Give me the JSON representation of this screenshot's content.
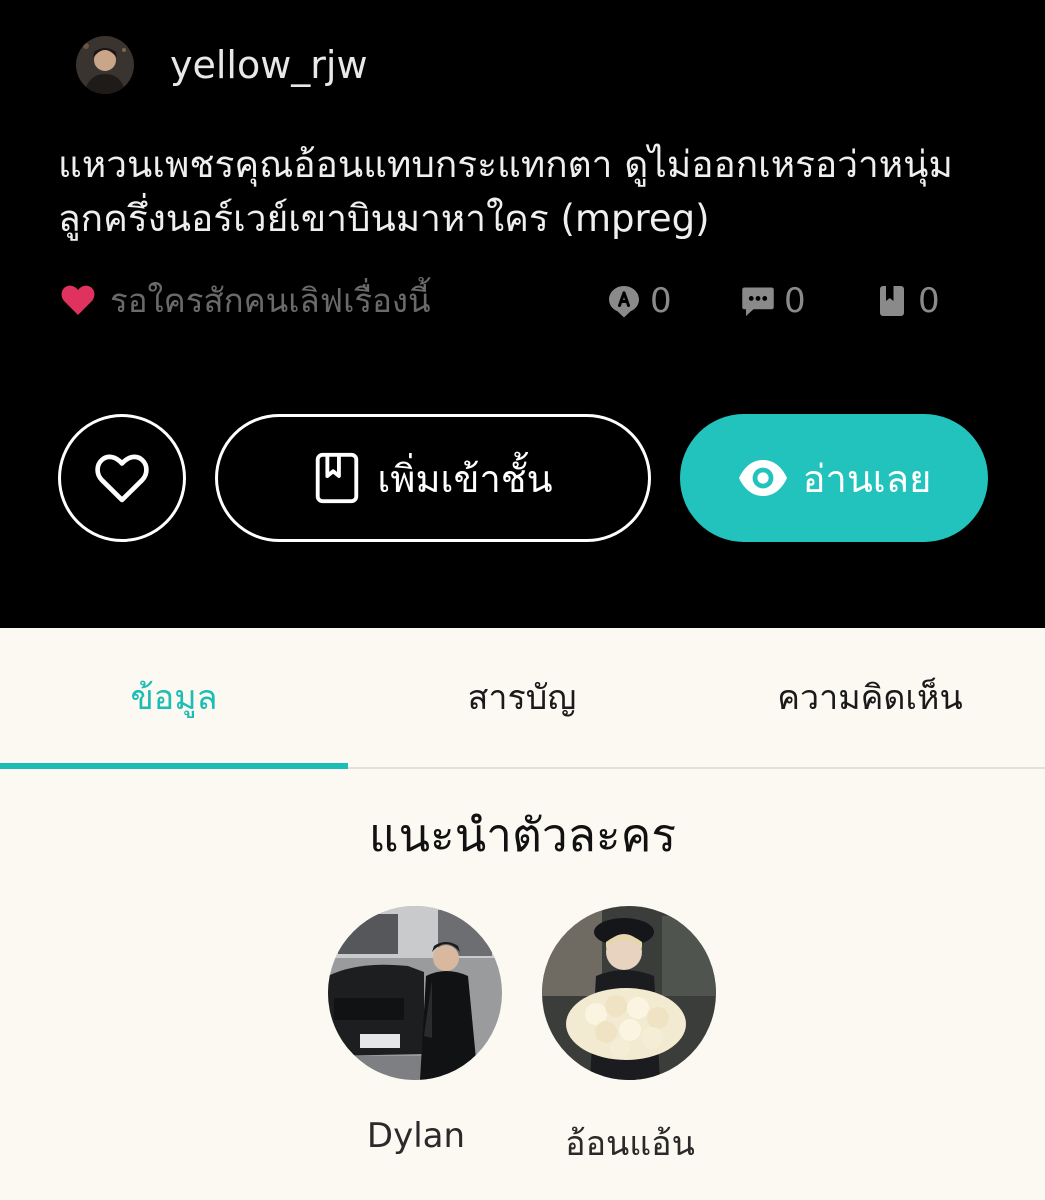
{
  "author": {
    "username": "yellow_rjw"
  },
  "story": {
    "title": "แหวนเพชรคุณอ้อนแทบกระแทกตา ดูไม่ออกเหรอว่าหนุ่มลูกครึ่งนอร์เวย์เขาบินมาหาใคร (mpreg)",
    "likes_text": "รอใครสักคนเลิฟเรื่องนี้",
    "stats": {
      "chapters": "0",
      "comments": "0",
      "shelves": "0"
    }
  },
  "actions": {
    "add_to_shelf": "เพิ่มเข้าชั้น",
    "read_now": "อ่านเลย"
  },
  "tabs": [
    {
      "label": "ข้อมูล",
      "active": true
    },
    {
      "label": "สารบัญ",
      "active": false
    },
    {
      "label": "ความคิดเห็น",
      "active": false
    }
  ],
  "characters_section": {
    "title": "แนะนำตัวละคร",
    "characters": [
      {
        "name": "Dylan"
      },
      {
        "name": "อ้อนแอ้น"
      }
    ]
  },
  "colors": {
    "accent": "#1bbdb5",
    "read_button": "#22c3bc",
    "heart": "#e0325f",
    "header_bg": "#000000",
    "content_bg": "#fcf8f2"
  },
  "icons": {
    "heart_small": "heart-icon",
    "chapters": "chapter-badge-icon",
    "comments": "comment-icon",
    "shelves": "bookmark-icon",
    "like_button": "heart-outline-icon",
    "shelf_button": "book-icon",
    "read_button": "eye-icon"
  }
}
